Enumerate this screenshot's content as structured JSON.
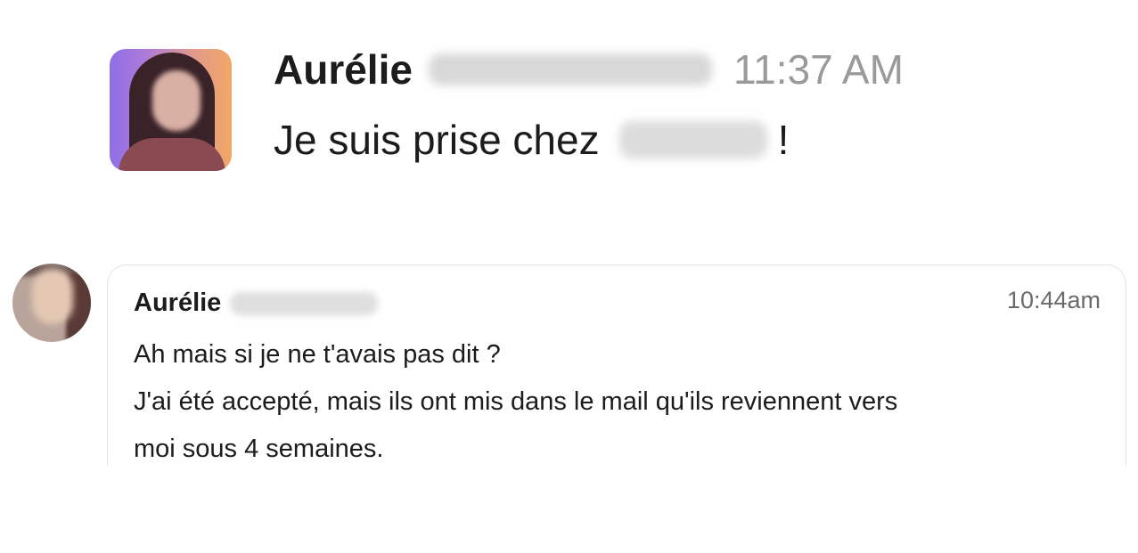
{
  "top_message": {
    "author_first_name": "Aurélie",
    "timestamp": "11:37 AM",
    "text_before": "Je suis prise chez",
    "text_after": "!",
    "avatar_icon": "user-avatar-photo"
  },
  "card_message": {
    "author_first_name": "Aurélie",
    "timestamp": "10:44am",
    "lines": [
      "Ah mais si je ne t'avais pas dit ?",
      "J'ai été accepté, mais ils ont mis dans le mail qu'ils reviennent vers",
      "moi sous 4 semaines."
    ],
    "avatar_icon": "user-avatar-photo"
  },
  "colors": {
    "text": "#1d1c1d",
    "timestamp_top": "#9a9a9a",
    "timestamp_card": "#6b6b6b",
    "card_border": "#e4e4e4"
  }
}
